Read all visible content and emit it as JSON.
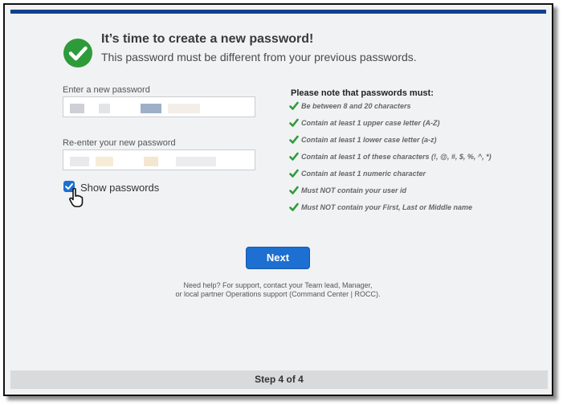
{
  "header": {
    "title": "It’s time to create a new password!",
    "subtitle": "This password must be different from your previous passwords."
  },
  "form": {
    "new_password_label": "Enter a new password",
    "confirm_password_label": "Re-enter your new password",
    "show_passwords_label": "Show passwords",
    "show_passwords_checked": true
  },
  "rules": {
    "title": "Please note that passwords must:",
    "items": [
      "Be between 8 and 20 characters",
      "Contain at least 1 upper case letter (A-Z)",
      "Contain at least 1 lower case letter (a-z)",
      "Contain at least 1 of these characters (!, @, #, $, %, ^, *)",
      "Contain at least 1 numeric character",
      "Must NOT contain your user id",
      "Must NOT contain your First, Last or Middle name"
    ]
  },
  "actions": {
    "next_label": "Next"
  },
  "help": {
    "line1": "Need help?  For support, contact your Team lead, Manager,",
    "line2": "or local partner Operations support (Command Center | ROCC)."
  },
  "footer": {
    "step_label": "Step 4 of 4"
  },
  "colors": {
    "accent": "#1d6fd1",
    "top_bar": "#13428c",
    "success": "#2e9b3a"
  }
}
